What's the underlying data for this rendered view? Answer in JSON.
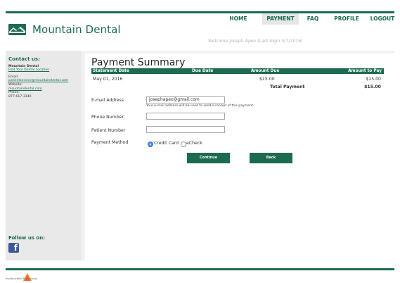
{
  "brand": {
    "name": "Mountain Dental",
    "accent": "#1d6a52"
  },
  "nav": {
    "items": [
      {
        "label": "HOME",
        "active": false
      },
      {
        "label": "PAYMENT",
        "active": true
      },
      {
        "label": "FAQ",
        "active": false
      },
      {
        "label": "PROFILE",
        "active": false
      },
      {
        "label": "LOGOUT",
        "active": false
      }
    ]
  },
  "welcome": "Welcome Joseph Apex (Last login 5/7/2016)",
  "sidebar": {
    "contact_title": "Contact us:",
    "org_name": "Mountain Dental",
    "find_location": "Find Your Dental Location",
    "email_label": "Email:",
    "email": "patientservice@mountaindental.com",
    "website_label": "Website:",
    "website": "mountaindental.com",
    "phone_label": "Phone:",
    "phone": "877-617-3140",
    "follow_title": "Follow us on:",
    "facebook_glyph": "f"
  },
  "payment": {
    "title": "Payment Summary",
    "columns": [
      "Statement Date",
      "Due Date",
      "Amount Due",
      "Amount to Pay"
    ],
    "row": {
      "statement_date": "May 01, 2016",
      "due_date": "",
      "amount_due": "$15.00",
      "amount_to_pay": "$15.00"
    },
    "total_label": "Total Payment",
    "total_value": "$15.00"
  },
  "form": {
    "email_label": "E-mail Address",
    "email_value": "josephapex@gmail.com",
    "email_note": "Your e-mail address will be used to send a receipt of this payment.",
    "phone_label": "Phone Number",
    "phone_value": "",
    "patient_label": "Patient Number",
    "patient_value": "",
    "method_label": "Payment Method",
    "method_options": [
      {
        "label": "Credit Card",
        "selected": true
      },
      {
        "label": "eCheck",
        "selected": false
      }
    ]
  },
  "buttons": {
    "continue": "Continue",
    "back": "Back"
  },
  "footer": {
    "powered_by": "mySecureBill Powered by"
  }
}
